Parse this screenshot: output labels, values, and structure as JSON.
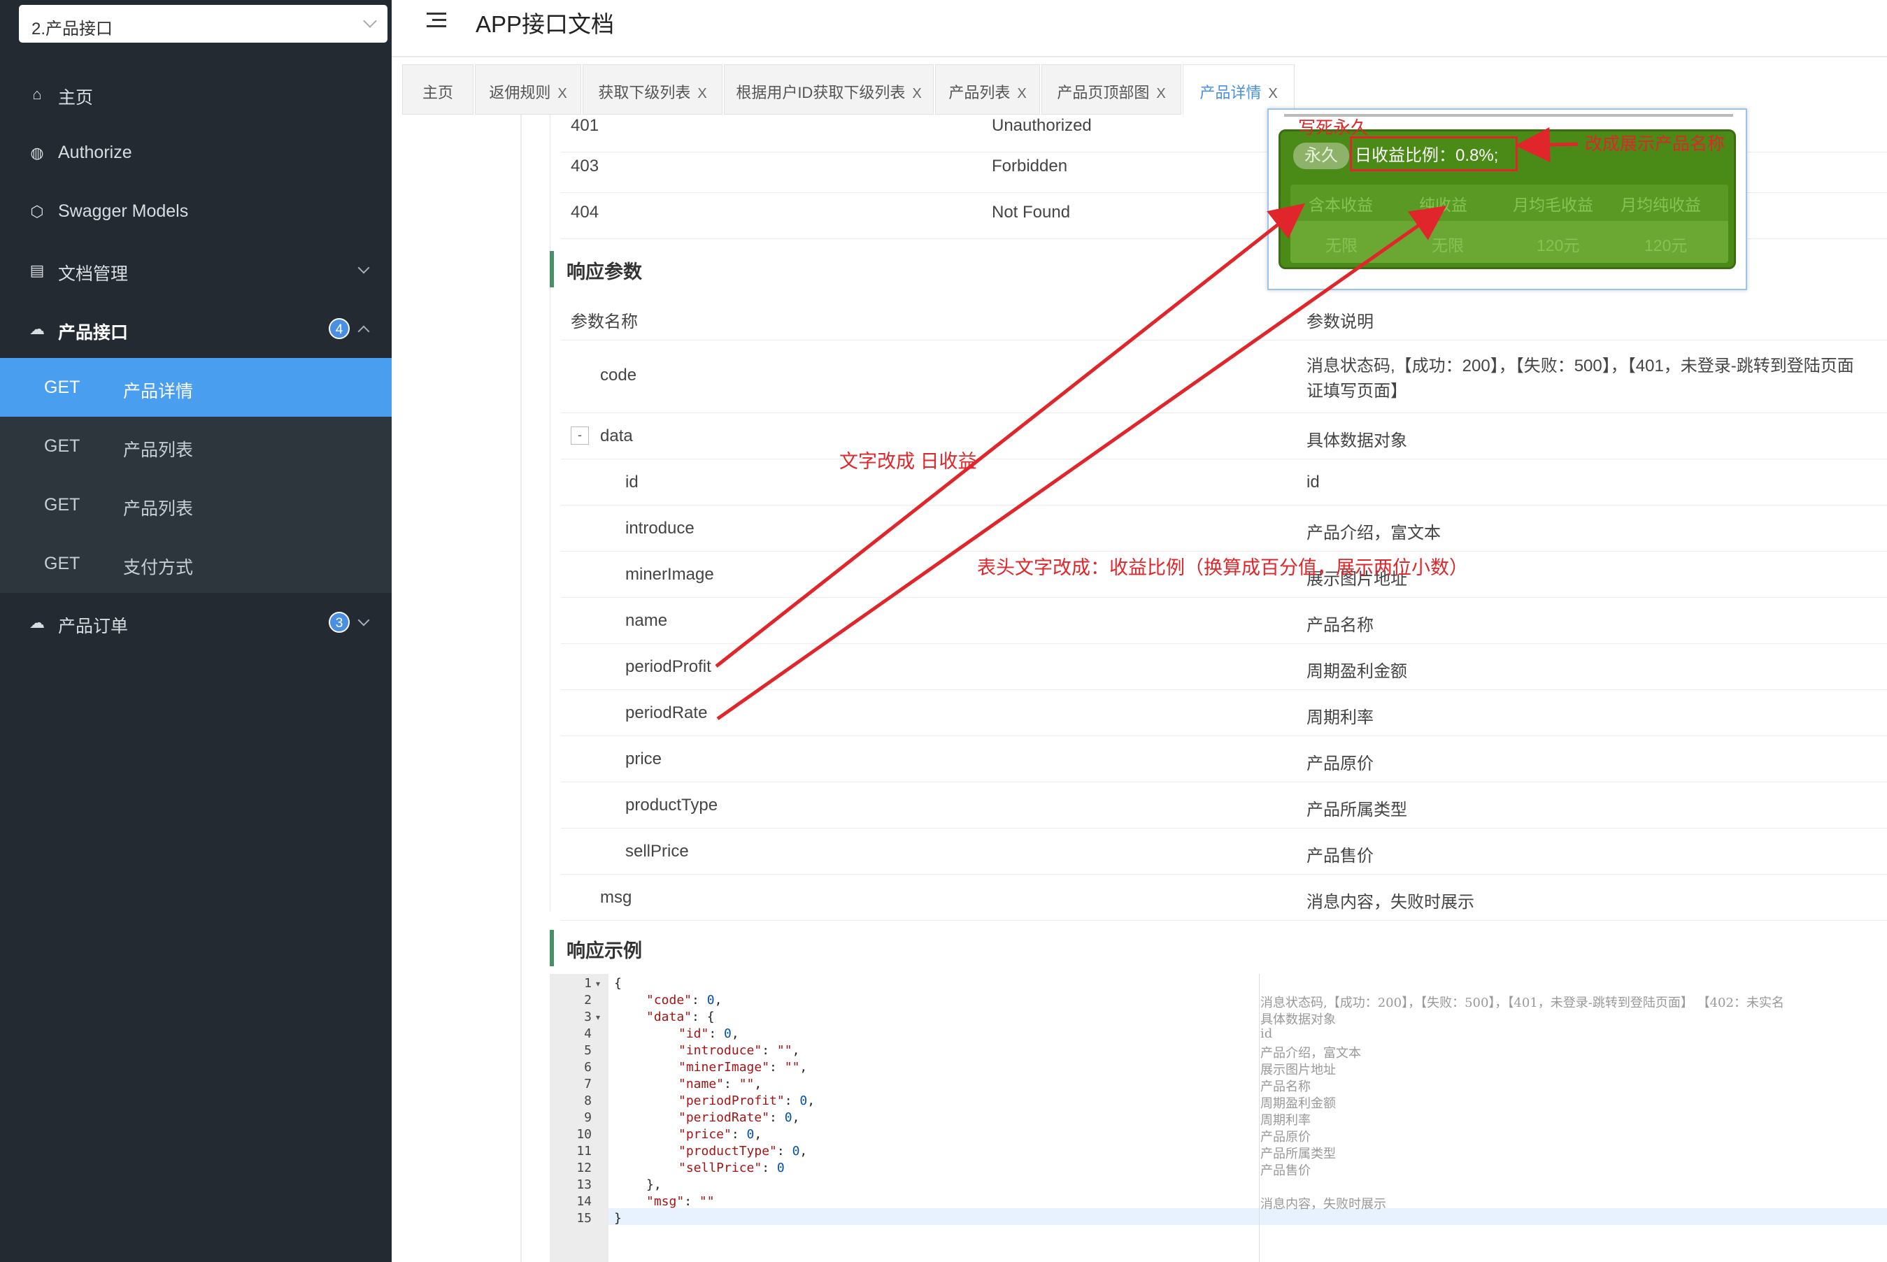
{
  "sidebar": {
    "group_select": "2.产品接口",
    "items": [
      {
        "label": "主页",
        "icon": "home-icon"
      },
      {
        "label": "Authorize",
        "icon": "lock-icon"
      },
      {
        "label": "Swagger Models",
        "icon": "cube-icon"
      },
      {
        "label": "文档管理",
        "icon": "document-icon"
      },
      {
        "label": "产品接口",
        "icon": "cloud-icon",
        "badge": "4"
      },
      {
        "label": "产品订单",
        "icon": "cloud-icon",
        "badge": "3"
      }
    ],
    "subitems": [
      {
        "method": "GET",
        "label": "产品详情"
      },
      {
        "method": "GET",
        "label": "产品列表"
      },
      {
        "method": "GET",
        "label": "产品列表"
      },
      {
        "method": "GET",
        "label": "支付方式"
      }
    ]
  },
  "header": {
    "title": "APP接口文档"
  },
  "tabs": [
    {
      "label": "主页"
    },
    {
      "label": "返佣规则",
      "close": "X"
    },
    {
      "label": "获取下级列表",
      "close": "X"
    },
    {
      "label": "根据用户ID获取下级列表",
      "close": "X"
    },
    {
      "label": "产品列表",
      "close": "X"
    },
    {
      "label": "产品页顶部图",
      "close": "X"
    },
    {
      "label": "产品详情",
      "close": "X"
    }
  ],
  "status_codes": [
    {
      "code": "401",
      "msg": "Unauthorized"
    },
    {
      "code": "403",
      "msg": "Forbidden"
    },
    {
      "code": "404",
      "msg": "Not Found"
    }
  ],
  "response_params": {
    "title": "响应参数",
    "header": {
      "name": "参数名称",
      "desc": "参数说明"
    },
    "rows": [
      {
        "name": "code",
        "desc": "消息状态码,【成功：200】，【失败：500】，【401，未登录-跳转到登陆页面",
        "desc2": "证填写页面】"
      },
      {
        "name": "data",
        "desc": "具体数据对象",
        "collapse": "-"
      },
      {
        "name": "id",
        "desc": "id"
      },
      {
        "name": "introduce",
        "desc": "产品介绍，富文本"
      },
      {
        "name": "minerImage",
        "desc": "展示图片地址"
      },
      {
        "name": "name",
        "desc": "产品名称"
      },
      {
        "name": "periodProfit",
        "desc": "周期盈利金额"
      },
      {
        "name": "periodRate",
        "desc": "周期利率"
      },
      {
        "name": "price",
        "desc": "产品原价"
      },
      {
        "name": "productType",
        "desc": "产品所属类型"
      },
      {
        "name": "sellPrice",
        "desc": "产品售价"
      },
      {
        "name": "msg",
        "desc": "消息内容，失败时展示"
      }
    ]
  },
  "response_example": {
    "title": "响应示例",
    "lines": [
      {
        "n": "1",
        "fold": "▾",
        "text": "{"
      },
      {
        "n": "2",
        "key": "\"code\"",
        "val": "0",
        "tail": ","
      },
      {
        "n": "3",
        "fold": "▾",
        "key": "\"data\"",
        "val": "{",
        "tail": ""
      },
      {
        "n": "4",
        "key": "\"id\"",
        "val": "0",
        "tail": ","
      },
      {
        "n": "5",
        "key": "\"introduce\"",
        "val": "\"\"",
        "tail": ","
      },
      {
        "n": "6",
        "key": "\"minerImage\"",
        "val": "\"\"",
        "tail": ","
      },
      {
        "n": "7",
        "key": "\"name\"",
        "val": "\"\"",
        "tail": ","
      },
      {
        "n": "8",
        "key": "\"periodProfit\"",
        "val": "0",
        "tail": ","
      },
      {
        "n": "9",
        "key": "\"periodRate\"",
        "val": "0",
        "tail": ","
      },
      {
        "n": "10",
        "key": "\"price\"",
        "val": "0",
        "tail": ","
      },
      {
        "n": "11",
        "key": "\"productType\"",
        "val": "0",
        "tail": ","
      },
      {
        "n": "12",
        "key": "\"sellPrice\"",
        "val": "0",
        "tail": ""
      },
      {
        "n": "13",
        "text": "},"
      },
      {
        "n": "14",
        "key": "\"msg\"",
        "val": "\"\"",
        "tail": ""
      },
      {
        "n": "15",
        "text": "}"
      }
    ],
    "comments": [
      "消息状态码,【成功：200】，【失败：500】，【401，未登录-跳转到登陆页面】 【402：未实名",
      "具体数据对象",
      "id",
      "产品介绍，富文本",
      "展示图片地址",
      "产品名称",
      "周期盈利金额",
      "周期利率",
      "产品原价",
      "产品所属类型",
      "产品售价",
      "消息内容，失败时展示"
    ]
  },
  "overlay": {
    "top_note": "写死永久",
    "badge": "永久",
    "daily_rate": "日收益比例：0.8%;",
    "cols": [
      "含本收益",
      "纯收益",
      "月均毛收益",
      "月均纯收益"
    ],
    "vals": [
      "无限",
      "无限",
      "120元",
      "120元"
    ]
  },
  "annotations": {
    "product_name": "改成展示产品名称",
    "daily_profit": "文字改成 日收益",
    "header_rate": "表头文字改成：收益比例（换算成百分值，展示两位小数）",
    "color": "#e0262a"
  }
}
